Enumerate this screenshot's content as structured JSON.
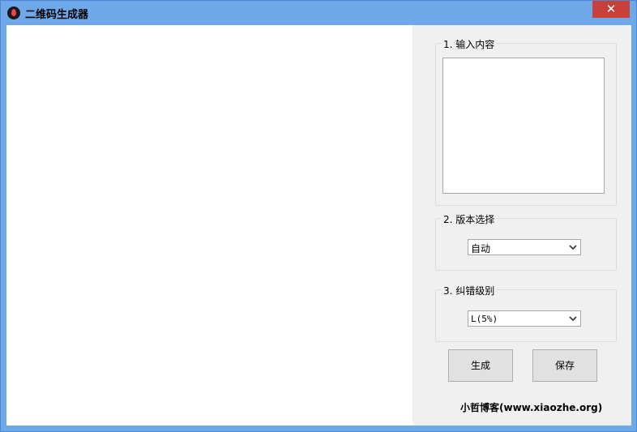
{
  "window": {
    "title": "二维码生成器"
  },
  "input_group": {
    "legend": "1. 输入内容",
    "value": ""
  },
  "version_group": {
    "legend": "2. 版本选择",
    "selected": "自动"
  },
  "ecc_group": {
    "legend": "3. 纠错级别",
    "selected": "L(5%)"
  },
  "buttons": {
    "generate": "生成",
    "save": "保存"
  },
  "footer": {
    "text": "小哲博客(www.xiaozhe.org)"
  },
  "icons": {
    "app": "app-logo-icon",
    "close": "close-icon",
    "dropdown": "chevron-down-icon"
  },
  "colors": {
    "titlebar": "#6fa8e8",
    "close": "#c7403a",
    "panel": "#f0f0f0"
  }
}
